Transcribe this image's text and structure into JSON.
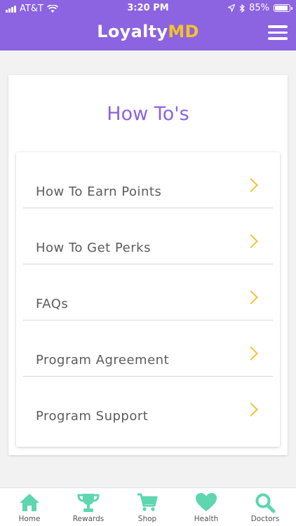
{
  "status_bar": {
    "carrier": "AT&T",
    "time": "3:20 PM",
    "battery": "85%"
  },
  "header": {
    "brand_main": "Loyalty",
    "brand_accent": "MD",
    "menu_icon": "hamburger-menu-icon"
  },
  "main": {
    "title": "How To's",
    "items": [
      {
        "label": "How To Earn Points"
      },
      {
        "label": "How To Get Perks"
      },
      {
        "label": "FAQs"
      },
      {
        "label": "Program Agreement"
      },
      {
        "label": "Program Support"
      }
    ]
  },
  "tabbar": {
    "tabs": [
      {
        "label": "Home",
        "icon": "home-icon"
      },
      {
        "label": "Rewards",
        "icon": "trophy-icon"
      },
      {
        "label": "Shop",
        "icon": "cart-icon"
      },
      {
        "label": "Health",
        "icon": "heart-icon"
      },
      {
        "label": "Doctors",
        "icon": "search-icon"
      }
    ]
  },
  "colors": {
    "brand_purple": "#8c63e0",
    "accent_yellow": "#f4c22b",
    "tab_teal": "#5ed6b0"
  }
}
